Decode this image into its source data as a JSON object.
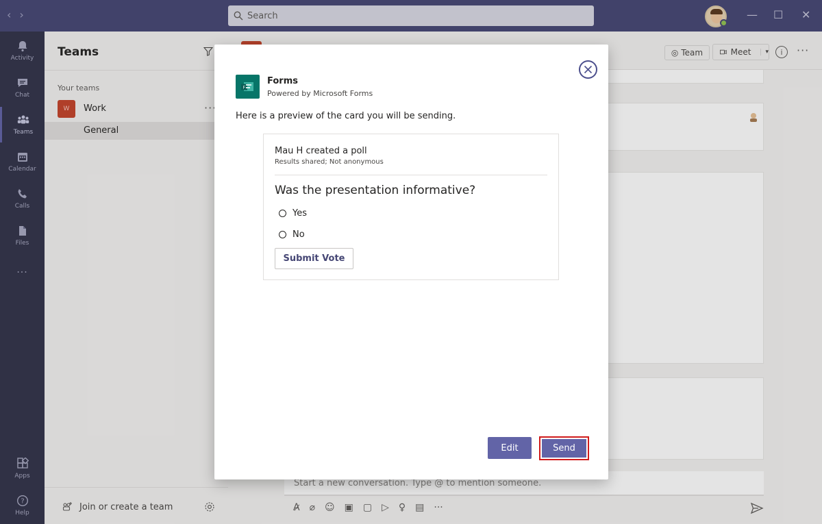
{
  "titlebar": {
    "search_placeholder": "Search",
    "back_glyph": "‹",
    "forward_glyph": "›",
    "minimize_glyph": "—",
    "maximize_glyph": "☐",
    "close_glyph": "✕"
  },
  "rail": {
    "items": [
      {
        "label": "Activity",
        "icon": "bell-icon"
      },
      {
        "label": "Chat",
        "icon": "chat-icon"
      },
      {
        "label": "Teams",
        "icon": "teams-icon"
      },
      {
        "label": "Calendar",
        "icon": "calendar-icon"
      },
      {
        "label": "Calls",
        "icon": "phone-icon"
      },
      {
        "label": "Files",
        "icon": "file-icon"
      },
      {
        "label": "...",
        "icon": "more-icon"
      },
      {
        "label": "Apps",
        "icon": "apps-icon"
      },
      {
        "label": "Help",
        "icon": "help-icon"
      }
    ]
  },
  "pane": {
    "title": "Teams",
    "section_label": "Your teams",
    "team_initial": "W",
    "team_name": "Work",
    "team_more": "···",
    "channel": "General",
    "join_label": "Join or create a team"
  },
  "main": {
    "team_button": "Team",
    "meet_button": "Meet",
    "info_glyph": "i",
    "more_glyph": "···",
    "compose_placeholder": "Start a new conversation. Type @ to mention someone."
  },
  "modal": {
    "app_name": "Forms",
    "app_subtitle": "Powered by Microsoft Forms",
    "preview_text": "Here is a preview of the card you will be sending.",
    "poll": {
      "creator_line": "Mau H created a poll",
      "meta": "Results shared; Not anonymous",
      "question": "Was the presentation informative?",
      "options": [
        "Yes",
        "No"
      ],
      "submit_label": "Submit Vote"
    },
    "edit_label": "Edit",
    "send_label": "Send"
  },
  "colors": {
    "accent": "#6264a7",
    "titlebar": "#464775",
    "rail": "#33344a",
    "forms_brand": "#077568",
    "highlight_border": "#d01b1b"
  }
}
